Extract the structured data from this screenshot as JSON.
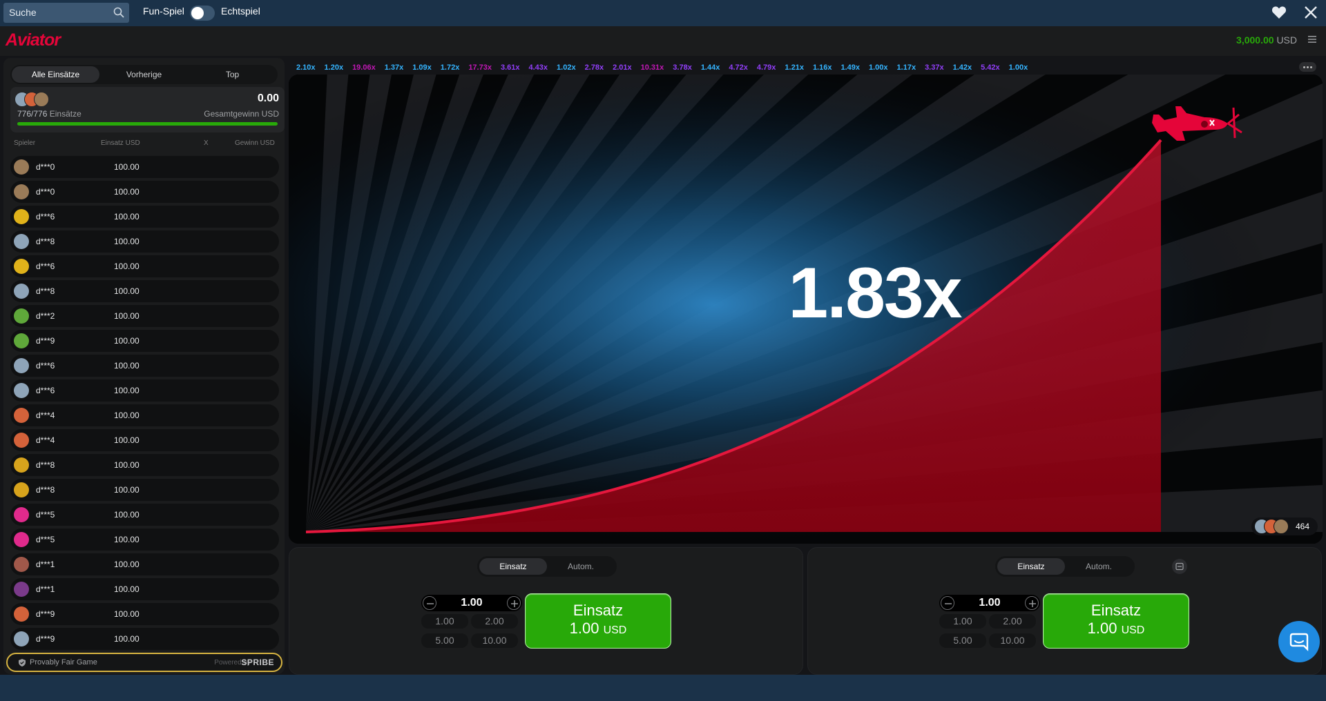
{
  "topbar": {
    "search_placeholder": "Suche",
    "fun_label": "Fun-Spiel",
    "real_label": "Echtspiel",
    "fun_mode_on": false
  },
  "game": {
    "logo": "Aviator",
    "balance_amount": "3,000.00",
    "balance_currency": "USD",
    "multiplier": "1.83x",
    "online_count": "464"
  },
  "history": [
    {
      "v": "2.10x",
      "c": "#34b4ff"
    },
    {
      "v": "1.20x",
      "c": "#34b4ff"
    },
    {
      "v": "19.06x",
      "c": "#c017b4"
    },
    {
      "v": "1.37x",
      "c": "#34b4ff"
    },
    {
      "v": "1.09x",
      "c": "#34b4ff"
    },
    {
      "v": "1.72x",
      "c": "#34b4ff"
    },
    {
      "v": "17.73x",
      "c": "#c017b4"
    },
    {
      "v": "3.61x",
      "c": "#913ef8"
    },
    {
      "v": "4.43x",
      "c": "#913ef8"
    },
    {
      "v": "1.02x",
      "c": "#34b4ff"
    },
    {
      "v": "2.78x",
      "c": "#913ef8"
    },
    {
      "v": "2.01x",
      "c": "#913ef8"
    },
    {
      "v": "10.31x",
      "c": "#c017b4"
    },
    {
      "v": "3.78x",
      "c": "#913ef8"
    },
    {
      "v": "1.44x",
      "c": "#34b4ff"
    },
    {
      "v": "4.72x",
      "c": "#913ef8"
    },
    {
      "v": "4.79x",
      "c": "#913ef8"
    },
    {
      "v": "1.21x",
      "c": "#34b4ff"
    },
    {
      "v": "1.16x",
      "c": "#34b4ff"
    },
    {
      "v": "1.49x",
      "c": "#34b4ff"
    },
    {
      "v": "1.00x",
      "c": "#34b4ff"
    },
    {
      "v": "1.17x",
      "c": "#34b4ff"
    },
    {
      "v": "3.37x",
      "c": "#913ef8"
    },
    {
      "v": "1.42x",
      "c": "#34b4ff"
    },
    {
      "v": "5.42x",
      "c": "#913ef8"
    },
    {
      "v": "1.00x",
      "c": "#34b4ff"
    }
  ],
  "left": {
    "tabs": [
      "Alle Einsätze",
      "Vorherige",
      "Top"
    ],
    "total": "0.00",
    "count": "776/776",
    "count_label": "Einsätze",
    "total_label": "Gesamtgewinn USD",
    "progress": 1.0,
    "cols": {
      "player": "Spieler",
      "stake": "Einsatz USD",
      "x": "X",
      "win": "Gewinn USD"
    },
    "bets": [
      {
        "name": "d***0",
        "amount": "100.00",
        "avatar": "#9a7b58"
      },
      {
        "name": "d***0",
        "amount": "100.00",
        "avatar": "#9a7b58"
      },
      {
        "name": "d***6",
        "amount": "100.00",
        "avatar": "#e0b21a"
      },
      {
        "name": "d***8",
        "amount": "100.00",
        "avatar": "#8ea4b8"
      },
      {
        "name": "d***6",
        "amount": "100.00",
        "avatar": "#e0b21a"
      },
      {
        "name": "d***8",
        "amount": "100.00",
        "avatar": "#8ea4b8"
      },
      {
        "name": "d***2",
        "amount": "100.00",
        "avatar": "#5fa83a"
      },
      {
        "name": "d***9",
        "amount": "100.00",
        "avatar": "#5fa83a"
      },
      {
        "name": "d***6",
        "amount": "100.00",
        "avatar": "#8ea4b8"
      },
      {
        "name": "d***6",
        "amount": "100.00",
        "avatar": "#8ea4b8"
      },
      {
        "name": "d***4",
        "amount": "100.00",
        "avatar": "#d4623a"
      },
      {
        "name": "d***4",
        "amount": "100.00",
        "avatar": "#d4623a"
      },
      {
        "name": "d***8",
        "amount": "100.00",
        "avatar": "#d7a31c"
      },
      {
        "name": "d***8",
        "amount": "100.00",
        "avatar": "#d7a31c"
      },
      {
        "name": "d***5",
        "amount": "100.00",
        "avatar": "#e02a8c"
      },
      {
        "name": "d***5",
        "amount": "100.00",
        "avatar": "#e02a8c"
      },
      {
        "name": "d***1",
        "amount": "100.00",
        "avatar": "#a0584a"
      },
      {
        "name": "d***1",
        "amount": "100.00",
        "avatar": "#7a3a8a"
      },
      {
        "name": "d***9",
        "amount": "100.00",
        "avatar": "#d4623a"
      },
      {
        "name": "d***9",
        "amount": "100.00",
        "avatar": "#8ea4b8"
      }
    ],
    "fair_text": "Provably Fair Game",
    "powered": "Powered by",
    "brand": "SPRIBE"
  },
  "panels": [
    {
      "tab_bet": "Einsatz",
      "tab_auto": "Autom.",
      "stake": "1.00",
      "quick": [
        "1.00",
        "2.00",
        "5.00",
        "10.00"
      ],
      "btn_label": "Einsatz",
      "btn_amount": "1.00",
      "btn_currency": "USD"
    },
    {
      "tab_bet": "Einsatz",
      "tab_auto": "Autom.",
      "stake": "1.00",
      "quick": [
        "1.00",
        "2.00",
        "5.00",
        "10.00"
      ],
      "btn_label": "Einsatz",
      "btn_amount": "1.00",
      "btn_currency": "USD"
    }
  ]
}
